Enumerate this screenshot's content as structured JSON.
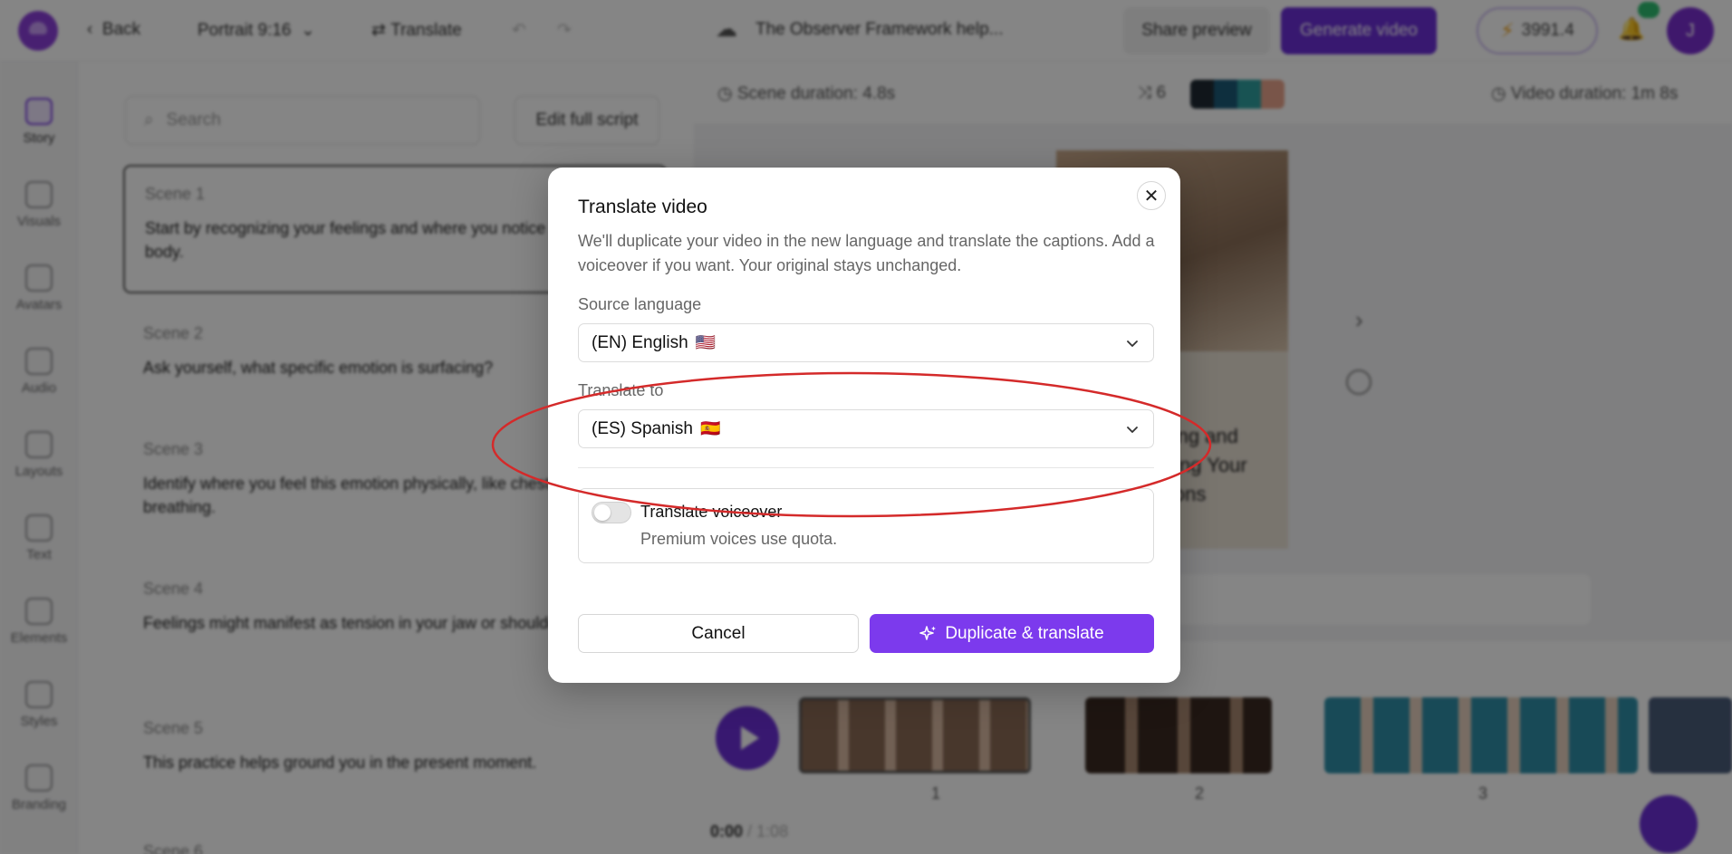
{
  "topbar": {
    "back_label": "Back",
    "aspect_label": "Portrait 9:16",
    "translate_label": "Translate",
    "project_title": "The Observer Framework help...",
    "share_label": "Share preview",
    "generate_label": "Generate video",
    "credits": "3991.4",
    "avatar_initial": "J"
  },
  "sidebar": {
    "items": [
      {
        "label": "Story",
        "icon": "story-icon"
      },
      {
        "label": "Visuals",
        "icon": "visuals-icon"
      },
      {
        "label": "Avatars",
        "icon": "avatars-icon"
      },
      {
        "label": "Audio",
        "icon": "audio-icon"
      },
      {
        "label": "Layouts",
        "icon": "layouts-icon"
      },
      {
        "label": "Text",
        "icon": "text-icon"
      },
      {
        "label": "Elements",
        "icon": "elements-icon"
      },
      {
        "label": "Styles",
        "icon": "styles-icon"
      },
      {
        "label": "Branding",
        "icon": "branding-icon"
      }
    ]
  },
  "script": {
    "search_placeholder": "Search",
    "edit_label": "Edit full script",
    "scenes": [
      {
        "title": "Scene 1",
        "text": "Start by recognizing your feelings and where you notice them in your body."
      },
      {
        "title": "Scene 2",
        "text": "Ask yourself, what specific emotion is surfacing?"
      },
      {
        "title": "Scene 3",
        "text": "Identify where you feel this emotion physically, like chest or shallow breathing."
      },
      {
        "title": "Scene 4",
        "text": "Feelings might manifest as tension in your jaw or shoulders too."
      },
      {
        "title": "Scene 5",
        "text": "This practice helps ground you in the present moment."
      },
      {
        "title": "Scene 6",
        "text": ""
      }
    ]
  },
  "preview": {
    "scene_duration": "Scene duration: 4.8s",
    "shuffle_count": "6",
    "video_duration": "Video duration: 1m 8s",
    "caption": "...gnizing and ...tanding Your ...motions",
    "timeline_numbers": [
      "1",
      "2",
      "3"
    ],
    "time_current": "0:00",
    "time_total": "/ 1:08",
    "swatch_colors": [
      "#1f2a33",
      "#1b5a78",
      "#2f9fa0",
      "#e8a48c"
    ]
  },
  "modal": {
    "title": "Translate video",
    "description": "We'll duplicate your video in the new language and translate the captions. Add a voiceover if you want. Your original stays unchanged.",
    "source_label": "Source language",
    "source_value": "(EN) English",
    "source_flag": "🇺🇸",
    "target_label": "Translate to",
    "target_value": "(ES) Spanish",
    "target_flag": "🇪🇸",
    "voiceover_title": "Translate voiceover",
    "voiceover_subtitle": "Premium voices use quota.",
    "voiceover_enabled": false,
    "cancel_label": "Cancel",
    "confirm_label": "Duplicate & translate",
    "accent_color": "#7c3aed"
  },
  "annotation_color": "#d42a2a"
}
